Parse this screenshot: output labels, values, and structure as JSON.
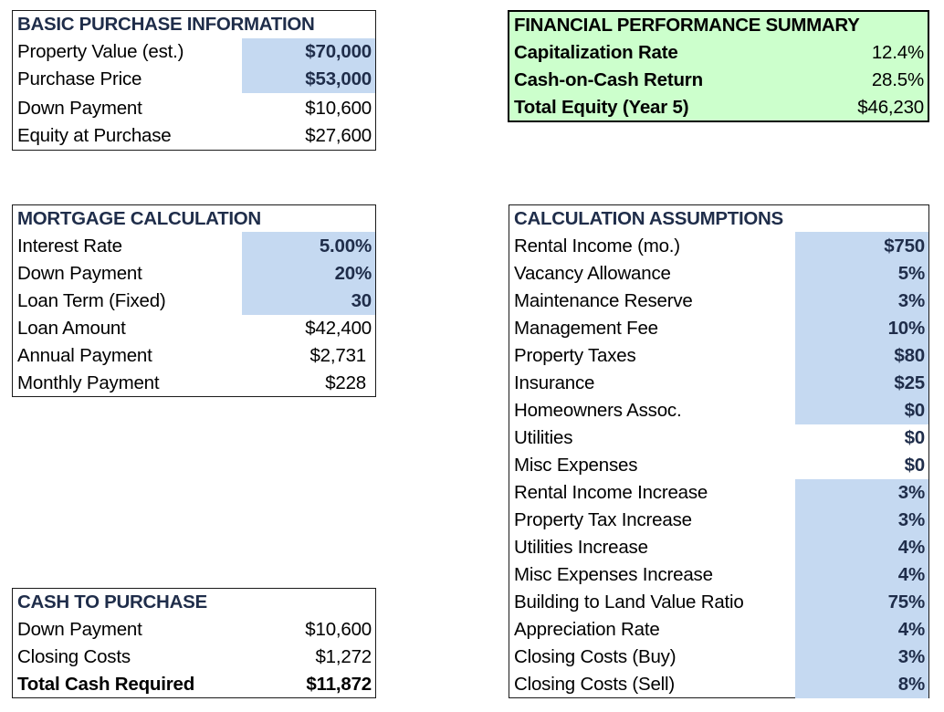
{
  "colors": {
    "input_highlight": "#c5d9f1",
    "summary_background": "#ccffcc",
    "header_text": "#1f2d4a"
  },
  "basic_purchase": {
    "title": "BASIC PURCHASE INFORMATION",
    "rows": [
      {
        "label": "Property Value (est.)",
        "value": "$70,000",
        "input": true
      },
      {
        "label": "Purchase Price",
        "value": "$53,000",
        "input": true
      },
      {
        "label": "Down Payment",
        "value": "$10,600",
        "input": false
      },
      {
        "label": "Equity at Purchase",
        "value": "$27,600",
        "input": false
      }
    ]
  },
  "financial_summary": {
    "title": "FINANCIAL PERFORMANCE SUMMARY",
    "rows": [
      {
        "label": "Capitalization Rate",
        "value": "12.4%"
      },
      {
        "label": "Cash-on-Cash Return",
        "value": "28.5%"
      },
      {
        "label": "Total Equity (Year 5)",
        "value": "$46,230"
      }
    ]
  },
  "mortgage": {
    "title": "MORTGAGE CALCULATION",
    "rows": [
      {
        "label": "Interest Rate",
        "value": "5.00%",
        "input": true
      },
      {
        "label": "Down Payment",
        "value": "20%",
        "input": true
      },
      {
        "label": "Loan Term (Fixed)",
        "value": "30",
        "input": true
      },
      {
        "label": "Loan Amount",
        "value": "$42,400",
        "input": false
      },
      {
        "label": "Annual Payment",
        "value": "$2,731",
        "input": false
      },
      {
        "label": "Monthly Payment",
        "value": "$228",
        "input": false
      }
    ]
  },
  "cash_to_purchase": {
    "title": "CASH TO PURCHASE",
    "rows": [
      {
        "label": "Down Payment",
        "value": "$10,600"
      },
      {
        "label": "Closing Costs",
        "value": "$1,272"
      },
      {
        "label": "Total Cash Required",
        "value": "$11,872"
      }
    ]
  },
  "assumptions": {
    "title": "CALCULATION ASSUMPTIONS",
    "rows": [
      {
        "label": "Rental Income (mo.)",
        "value": "$750",
        "input": true
      },
      {
        "label": "Vacancy Allowance",
        "value": "5%",
        "input": true
      },
      {
        "label": "Maintenance Reserve",
        "value": "3%",
        "input": true
      },
      {
        "label": "Management Fee",
        "value": "10%",
        "input": true
      },
      {
        "label": "Property Taxes",
        "value": "$80",
        "input": true
      },
      {
        "label": "Insurance",
        "value": "$25",
        "input": true
      },
      {
        "label": "Homeowners Assoc.",
        "value": "$0",
        "input": true
      },
      {
        "label": "Utilities",
        "value": "$0",
        "input": false
      },
      {
        "label": "Misc Expenses",
        "value": "$0",
        "input": false
      },
      {
        "label": "Rental Income Increase",
        "value": "3%",
        "input": true
      },
      {
        "label": "Property Tax Increase",
        "value": "3%",
        "input": true
      },
      {
        "label": "Utilities Increase",
        "value": "4%",
        "input": true
      },
      {
        "label": "Misc Expenses Increase",
        "value": "4%",
        "input": true
      },
      {
        "label": "Building to Land Value Ratio",
        "value": "75%",
        "input": true
      },
      {
        "label": "Appreciation Rate",
        "value": "4%",
        "input": true
      },
      {
        "label": "Closing Costs (Buy)",
        "value": "3%",
        "input": true
      },
      {
        "label": "Closing Costs (Sell)",
        "value": "8%",
        "input": true
      }
    ]
  }
}
